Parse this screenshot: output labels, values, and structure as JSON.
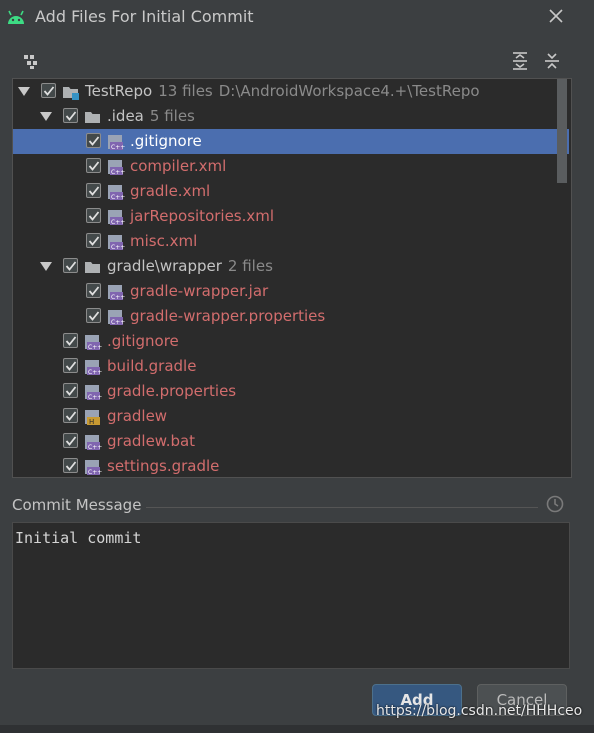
{
  "window": {
    "title": "Add Files For Initial Commit"
  },
  "colors": {
    "selection": "#4b6eaf",
    "unversioned_file": "#d26d6d",
    "button_primary": "#365880"
  },
  "tree": {
    "root": {
      "name": "TestRepo",
      "count": "13 files",
      "path": "D:\\AndroidWorkspace4.+\\TestRepo"
    },
    "idea": {
      "name": ".idea",
      "count": "5 files"
    },
    "idea_files": [
      ".gitignore",
      "compiler.xml",
      "gradle.xml",
      "jarRepositories.xml",
      "misc.xml"
    ],
    "gradle_wrapper": {
      "name": "gradle\\wrapper",
      "count": "2 files"
    },
    "wrapper_files": [
      "gradle-wrapper.jar",
      "gradle-wrapper.properties"
    ],
    "root_files": [
      ".gitignore",
      "build.gradle",
      "gradle.properties",
      "gradlew",
      "gradlew.bat",
      "settings.gradle"
    ]
  },
  "commit": {
    "label": "Commit Message",
    "text": "Initial commit"
  },
  "buttons": {
    "add": "Add",
    "cancel": "Cancel"
  },
  "watermark": "https://blog.csdn.net/HHHceo"
}
